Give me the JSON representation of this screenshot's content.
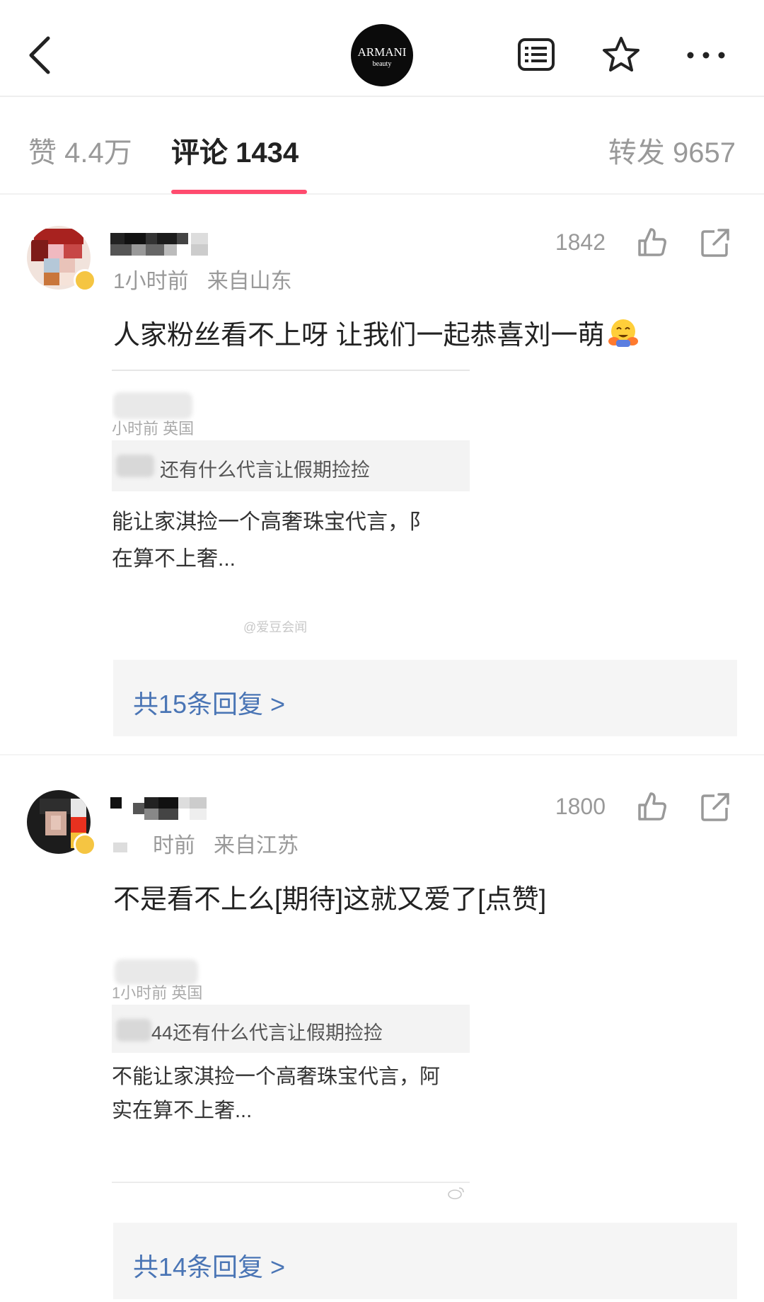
{
  "header": {
    "logo_main": "ARMANI",
    "logo_sub": "beauty",
    "icons": {
      "back": "back-icon",
      "list": "list-icon",
      "star": "star-icon",
      "more": "more-icon"
    }
  },
  "tabs": {
    "likes": "赞 4.4万",
    "comments": "评论 1434",
    "reposts": "转发 9657",
    "active_color": "#ff4b6e"
  },
  "comments": [
    {
      "time": "1小时前",
      "location": "来自山东",
      "likes": "1842",
      "text": "人家粉丝看不上呀 让我们一起恭喜刘一萌",
      "emoji": "hugging-face-icon",
      "embed": {
        "meta": "小时前 英国",
        "quote": "还有什么代言让假期捡捡",
        "body_line1": "能让家淇捡一个高奢珠宝代言，阝",
        "body_line2": "在算不上奢...",
        "watermark": "@爱豆会闻"
      },
      "replies": "共15条回复 >"
    },
    {
      "time": "时前",
      "location": "来自江苏",
      "likes": "1800",
      "text": "不是看不上么[期待]这就又爱了[点赞]",
      "embed": {
        "meta": "1小时前 英国",
        "quote": "44还有什么代言让假期捡捡",
        "body_line1": "不能让家淇捡一个高奢珠宝代言，阿",
        "body_line2": "实在算不上奢..."
      },
      "replies": "共14条回复 >"
    }
  ],
  "colors": {
    "link": "#4a75b5",
    "muted": "#999999",
    "badge": "#f5c542"
  }
}
